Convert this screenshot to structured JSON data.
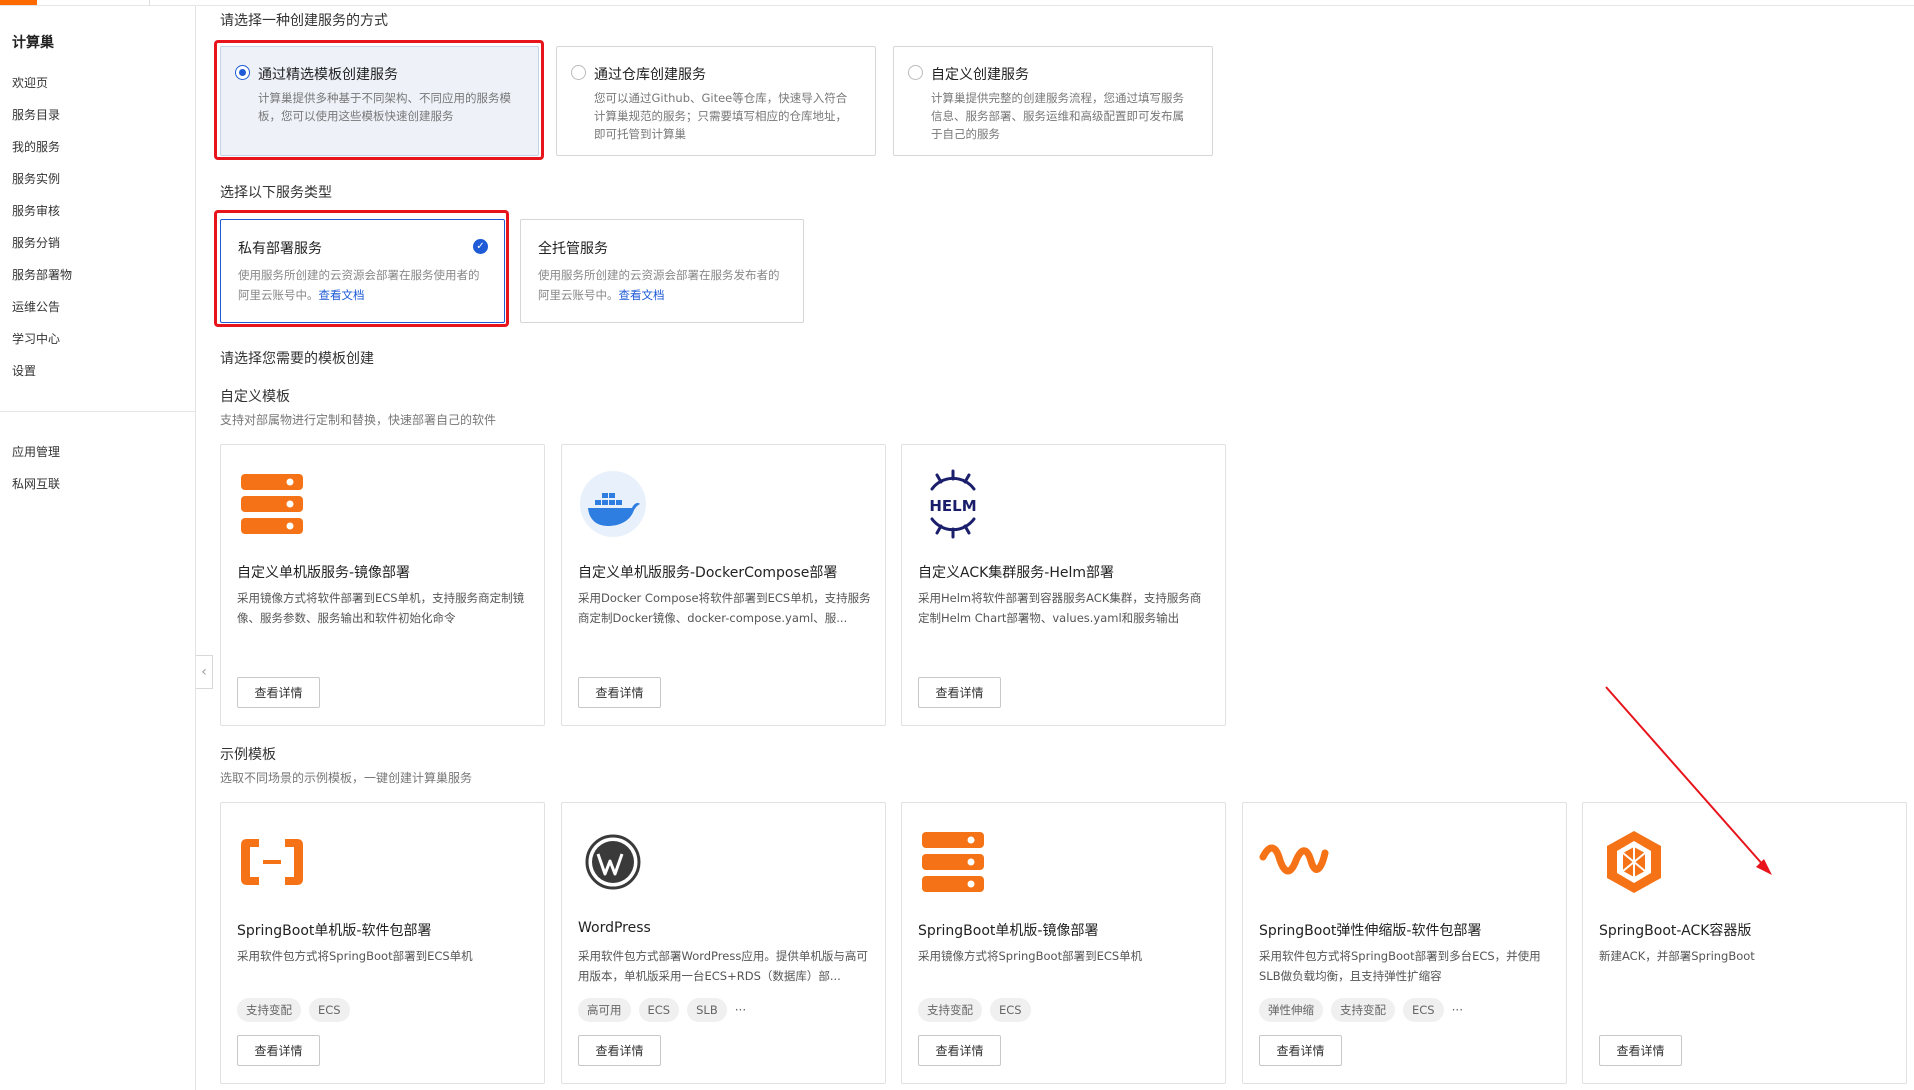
{
  "sidebar": {
    "title": "计算巢",
    "items": [
      "欢迎页",
      "服务目录",
      "我的服务",
      "服务实例",
      "服务审核",
      "服务分销",
      "服务部署物",
      "运维公告",
      "学习中心",
      "设置"
    ],
    "items2": [
      "应用管理",
      "私网互联"
    ]
  },
  "method": {
    "heading": "请选择一种创建服务的方式",
    "options": [
      {
        "title": "通过精选模板创建服务",
        "desc": "计算巢提供多种基于不同架构、不同应用的服务模板，您可以使用这些模板快速创建服务"
      },
      {
        "title": "通过仓库创建服务",
        "desc": "您可以通过Github、Gitee等仓库，快速导入符合计算巢规范的服务；只需要填写相应的仓库地址，即可托管到计算巢"
      },
      {
        "title": "自定义创建服务",
        "desc": "计算巢提供完整的创建服务流程，您通过填写服务信息、服务部署、服务运维和高级配置即可发布属于自己的服务"
      }
    ]
  },
  "service_type": {
    "heading": "选择以下服务类型",
    "options": [
      {
        "title": "私有部署服务",
        "desc": "使用服务所创建的云资源会部署在服务使用者的阿里云账号中。",
        "link": "查看文档"
      },
      {
        "title": "全托管服务",
        "desc": "使用服务所创建的云资源会部署在服务发布者的阿里云账号中。",
        "link": "查看文档"
      }
    ]
  },
  "template_heading": "请选择您需要的模板创建",
  "custom": {
    "title": "自定义模板",
    "subtitle": "支持对部属物进行定制和替换，快速部署自己的软件",
    "cards": [
      {
        "title": "自定义单机版服务-镜像部署",
        "desc": "采用镜像方式将软件部署到ECS单机，支持服务商定制镜像、服务参数、服务输出和软件初始化命令",
        "button": "查看详情",
        "icon": "server-stack-icon"
      },
      {
        "title": "自定义单机版服务-DockerCompose部署",
        "desc": "采用Docker Compose将软件部署到ECS单机，支持服务商定制Docker镜像、docker-compose.yaml、服...",
        "button": "查看详情",
        "icon": "docker-icon"
      },
      {
        "title": "自定义ACK集群服务-Helm部署",
        "desc": "采用Helm将软件部署到容器服务ACK集群，支持服务商定制Helm Chart部署物、values.yaml和服务输出",
        "button": "查看详情",
        "icon": "helm-icon",
        "logo_text": "HELM"
      }
    ]
  },
  "examples": {
    "title": "示例模板",
    "subtitle": "选取不同场景的示例模板，一键创建计算巢服务",
    "cards": [
      {
        "title": "SpringBoot单机版-软件包部署",
        "desc": "采用软件包方式将SpringBoot部署到ECS单机",
        "tags": [
          "支持变配",
          "ECS"
        ],
        "more": "",
        "button": "查看详情",
        "icon": "aliyun-icon"
      },
      {
        "title": "WordPress",
        "desc": "采用软件包方式部署WordPress应用。提供单机版与高可用版本，单机版采用一台ECS+RDS（数据库）部...",
        "tags": [
          "高可用",
          "ECS",
          "SLB"
        ],
        "more": "···",
        "button": "查看详情",
        "icon": "wordpress-icon"
      },
      {
        "title": "SpringBoot单机版-镜像部署",
        "desc": "采用镜像方式将SpringBoot部署到ECS单机",
        "tags": [
          "支持变配",
          "ECS"
        ],
        "more": "",
        "button": "查看详情",
        "icon": "server-stack-icon"
      },
      {
        "title": "SpringBoot弹性伸缩版-软件包部署",
        "desc": "采用软件包方式将SpringBoot部署到多台ECS，并使用SLB做负载均衡，且支持弹性扩缩容",
        "tags": [
          "弹性伸缩",
          "支持变配",
          "ECS"
        ],
        "more": "···",
        "button": "查看详情",
        "icon": "auto-scaling-icon"
      },
      {
        "title": "SpringBoot-ACK容器版",
        "desc": "新建ACK，并部署SpringBoot",
        "tags": [],
        "more": "",
        "button": "查看详情",
        "icon": "container-cube-icon"
      }
    ]
  },
  "colors": {
    "accent": "#ff6a00",
    "primary": "#1f5bd6",
    "highlight": "#e8141c"
  }
}
